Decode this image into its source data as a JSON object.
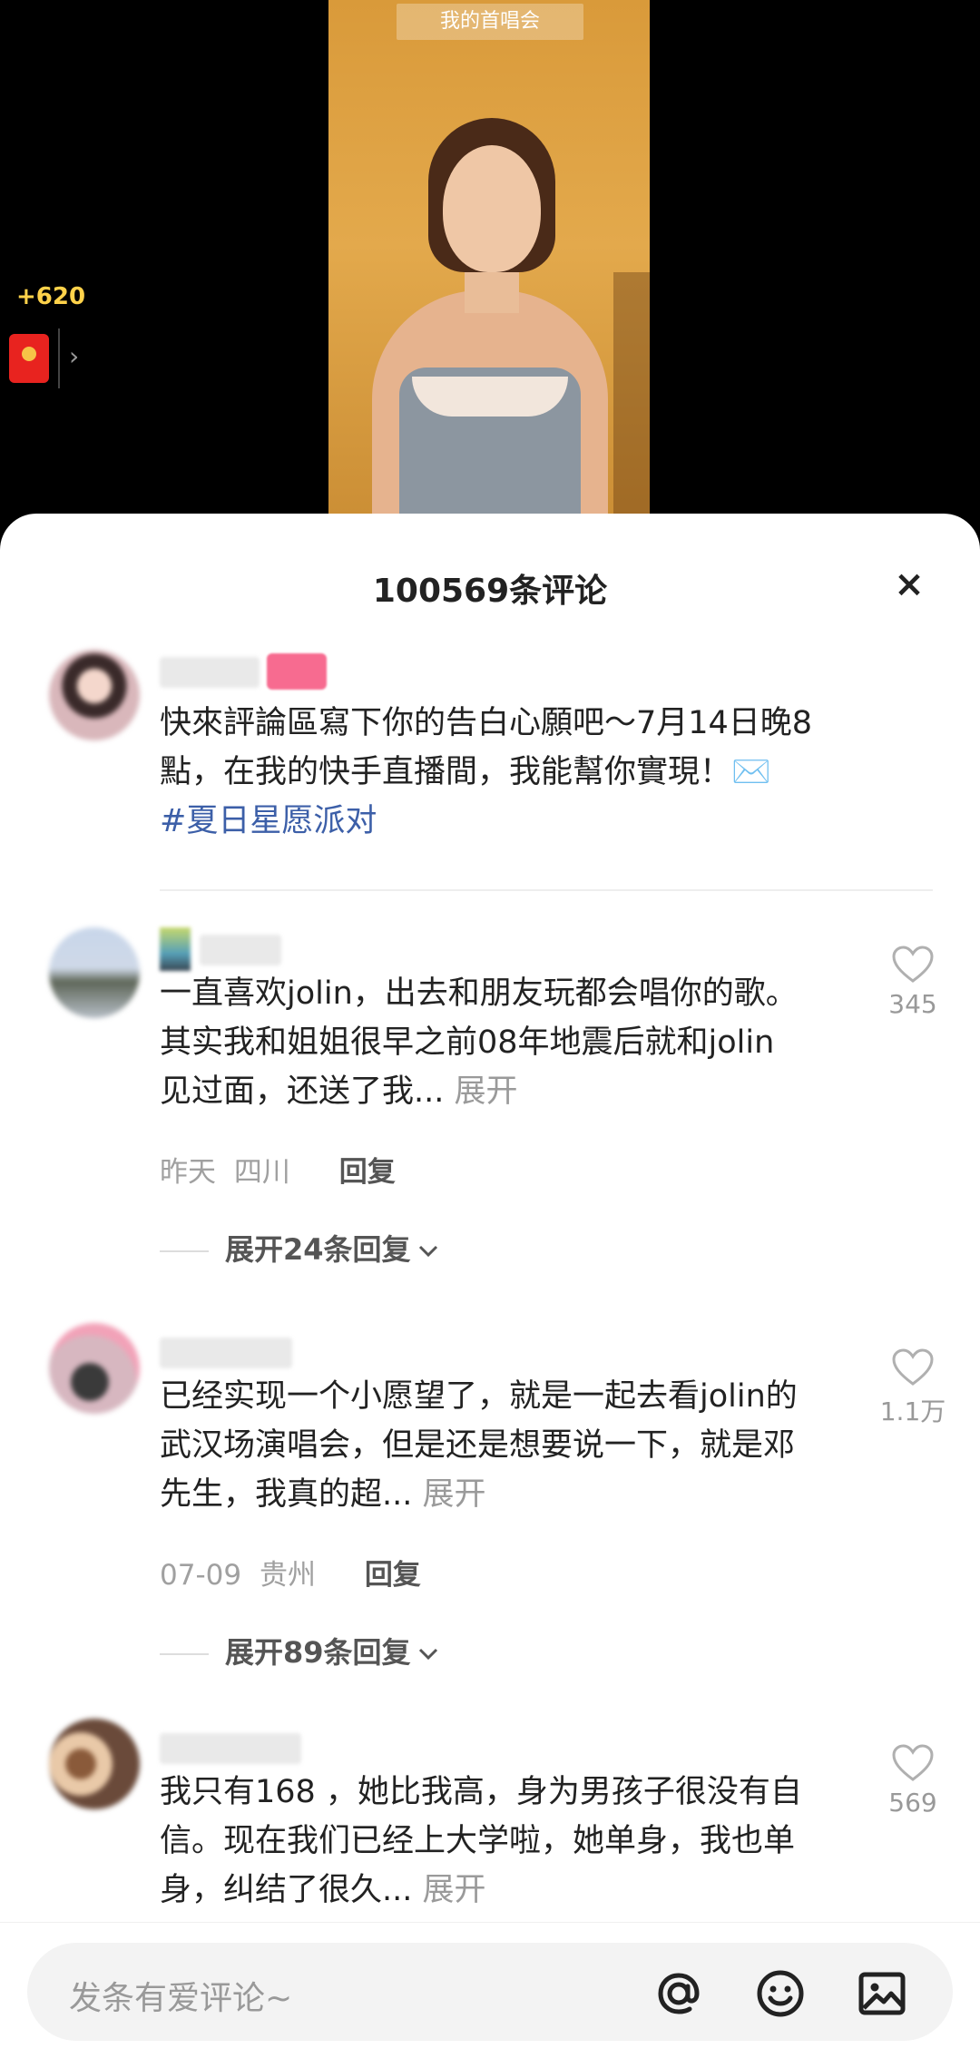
{
  "video": {
    "caption": "我的首唱会",
    "reward_count": "+620",
    "arrow": "›"
  },
  "comments_sheet": {
    "title": "100569条评论",
    "close_label": "×",
    "pinned": {
      "text": "快來評論區寫下你的告白心願吧～7月14日晚8點，在我的快手直播間，我能幫你實現！",
      "envelope": "✉️",
      "hashtag": "#夏日星愿派对"
    },
    "comments": [
      {
        "text": "一直喜欢jolin，出去和朋友玩都会唱你的歌。其实我和姐姐很早之前08年地震后就和jolin见过面，还送了我...",
        "expand": "展开",
        "date": "昨天",
        "location": "四川",
        "reply": "回复",
        "likes": "345",
        "replies": "展开24条回复"
      },
      {
        "text": "已经实现一个小愿望了，就是一起去看jolin的武汉场演唱会，但是还是想要说一下，就是邓先生，我真的超...",
        "expand": "展开",
        "date": "07-09",
        "location": "贵州",
        "reply": "回复",
        "likes": "1.1万",
        "replies": "展开89条回复"
      },
      {
        "text": "我只有168 ，她比我高，身为男孩子很没有自信。现在我们已经上大学啦，她单身，我也单身，纠结了很久...",
        "expand": "展开",
        "likes": "569"
      }
    ]
  },
  "input_bar": {
    "placeholder": "发条有爱评论~",
    "icons": [
      "at-icon",
      "emoji-icon",
      "image-icon"
    ]
  },
  "colors": {
    "hashtag": "#3c5fa8",
    "reward": "#ffd24a",
    "red_packet": "#e8231f",
    "badge": "#f76b90"
  }
}
